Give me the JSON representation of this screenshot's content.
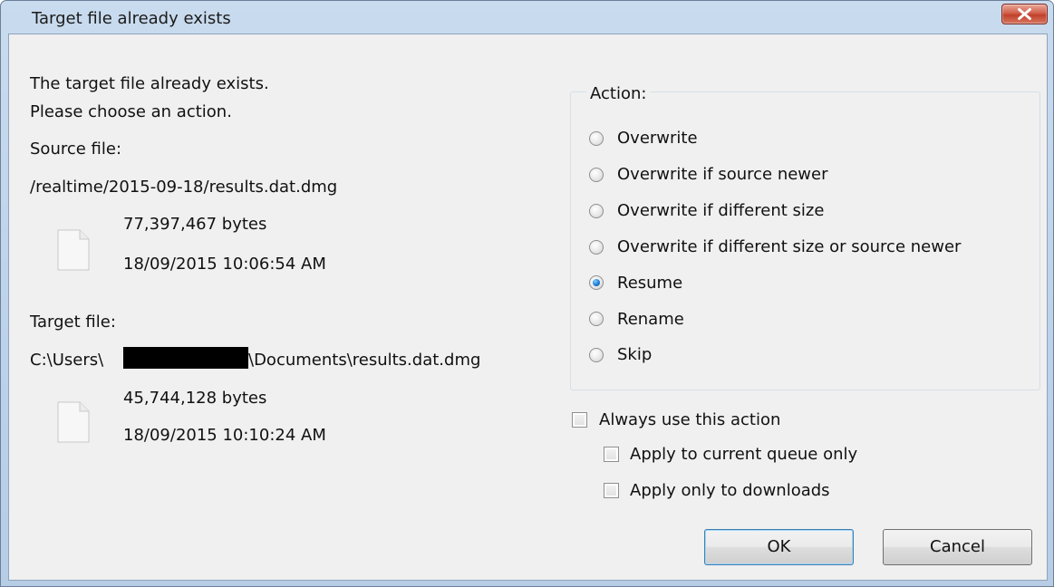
{
  "window": {
    "title": "Target file already exists"
  },
  "message": {
    "line1": "The target file already exists.",
    "line2": "Please choose an action."
  },
  "source": {
    "label": "Source file:",
    "path": "/realtime/2015-09-18/results.dat.dmg",
    "size": "77,397,467 bytes",
    "date": "18/09/2015 10:06:54 AM"
  },
  "target": {
    "label": "Target file:",
    "path_prefix": "C:\\Users\\",
    "path_suffix": "\\Documents\\results.dat.dmg",
    "size": "45,744,128 bytes",
    "date": "18/09/2015 10:10:24 AM"
  },
  "action": {
    "group_label": "Action:",
    "options": [
      {
        "label": "Overwrite",
        "checked": false
      },
      {
        "label": "Overwrite if source newer",
        "checked": false
      },
      {
        "label": "Overwrite if different size",
        "checked": false
      },
      {
        "label": "Overwrite if different size or source newer",
        "checked": false
      },
      {
        "label": "Resume",
        "checked": true
      },
      {
        "label": "Rename",
        "checked": false
      },
      {
        "label": "Skip",
        "checked": false
      }
    ]
  },
  "checkboxes": {
    "always": {
      "label": "Always use this action",
      "checked": false
    },
    "current_queue": {
      "label": "Apply to current queue only",
      "checked": false
    },
    "downloads_only": {
      "label": "Apply only to downloads",
      "checked": false
    }
  },
  "buttons": {
    "ok": "OK",
    "cancel": "Cancel"
  },
  "icons": {
    "close": "close-icon",
    "file": "file-icon"
  },
  "colors": {
    "titlebar": "#bcd2ea",
    "close_button": "#c2412b",
    "client_background": "#f0f0f0",
    "radio_selected": "#1f7bd4"
  }
}
